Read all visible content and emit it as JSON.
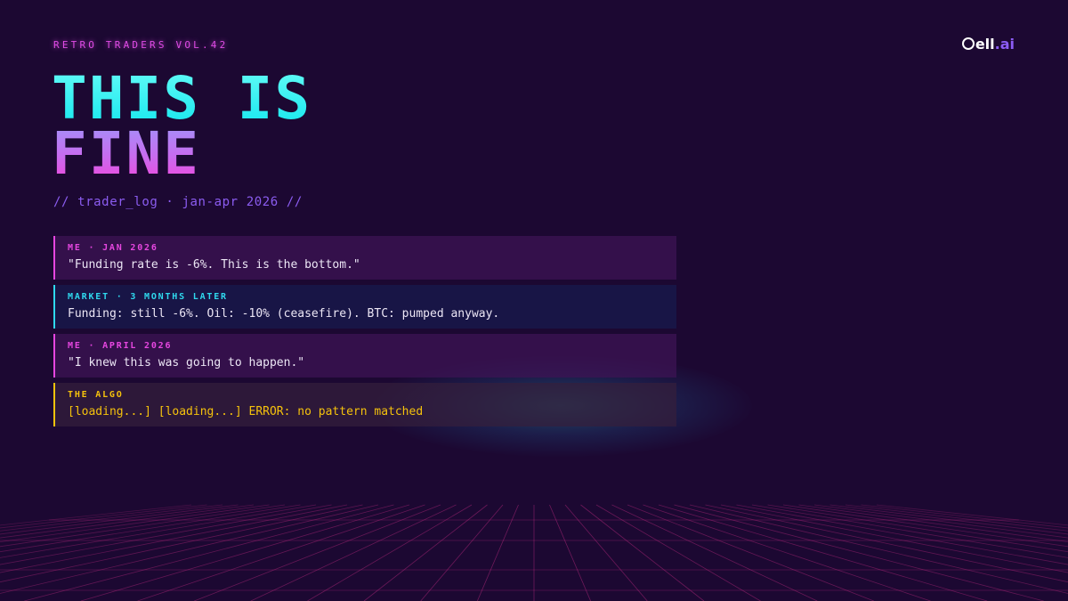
{
  "header": {
    "kicker": "RETRO TRADERS VOL.42",
    "brand_prefix": "ell",
    "brand_suffix": ".ai"
  },
  "title": {
    "line1": "THIS IS",
    "line2": "FINE"
  },
  "subtitle": "// trader_log · jan-apr 2026 //",
  "log": [
    {
      "kind": "me",
      "label": "ME · JAN 2026",
      "text": "\"Funding rate is -6%. This is the bottom.\""
    },
    {
      "kind": "market",
      "label": "MARKET · 3 MONTHS LATER",
      "text": "Funding: still -6%. Oil: -10% (ceasefire). BTC: pumped anyway."
    },
    {
      "kind": "me",
      "label": "ME · APRIL 2026",
      "text": "\"I knew this was going to happen.\""
    },
    {
      "kind": "algo",
      "label": "THE ALGO",
      "text": "[loading...] [loading...] ERROR: no pattern matched"
    }
  ],
  "colors": {
    "background": "#1c0832",
    "me": "#e646e0",
    "market": "#2fd9ee",
    "algo": "#f5c20c",
    "subtitle": "#8b5cf0",
    "grid": "#b4287c"
  },
  "icons": {
    "brand": "brand-logo-icon"
  }
}
